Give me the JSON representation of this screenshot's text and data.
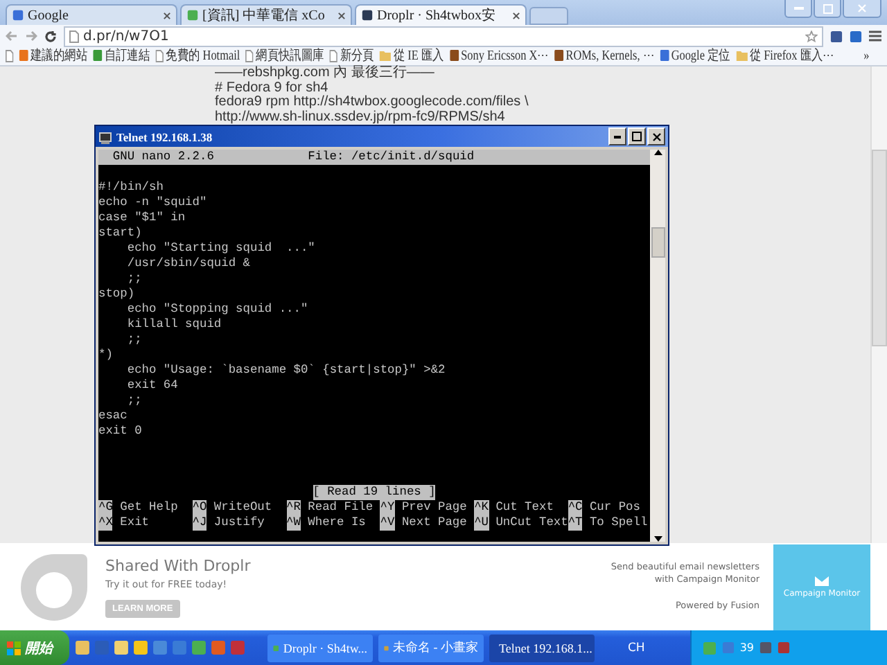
{
  "browser": {
    "tabs": [
      {
        "label": "Google",
        "selected": false
      },
      {
        "label": "[資訊] 中華電信 xCo",
        "selected": false
      },
      {
        "label": "Droplr · Sh4twbox安",
        "selected": true
      }
    ],
    "address": "d.pr/n/w7O1",
    "bookmarks": [
      {
        "label": "建議的網站",
        "kind": "site",
        "color": "#e8731c"
      },
      {
        "label": "自訂連結",
        "kind": "site",
        "color": "#3a9a3a"
      },
      {
        "label": "免費的 Hotmail",
        "kind": "page"
      },
      {
        "label": "網頁快訊圖庫",
        "kind": "page"
      },
      {
        "label": "新分頁",
        "kind": "page"
      },
      {
        "label": "從 IE 匯入",
        "kind": "folder"
      },
      {
        "label": "Sony Ericsson X⋯",
        "kind": "site",
        "color": "#8a4b1c"
      },
      {
        "label": "ROMs, Kernels, ⋯",
        "kind": "site",
        "color": "#8a4b1c"
      },
      {
        "label": "Google 定位",
        "kind": "site",
        "color": "#3a6fd8"
      },
      {
        "label": "從 Firefox 匯入⋯",
        "kind": "folder"
      }
    ],
    "more": "»",
    "page_lines": [
      "——rebshpkg.com 內 最後三行——",
      "# Fedora 9 for sh4",
      "fedora9 rpm http://sh4twbox.googlecode.com/files \\",
      "http://www.sh-linux.ssdev.jp/rpm-fc9/RPMS/sh4"
    ]
  },
  "telnet": {
    "title": "Telnet 192.168.1.38",
    "nano_version": "GNU nano 2.2.6",
    "file": "File: /etc/init.d/squid",
    "lines": [
      "#!/bin/sh",
      "echo -n \"squid\"",
      "case \"$1\" in",
      "start)",
      "    echo \"Starting squid  ...\"",
      "    /usr/sbin/squid &",
      "    ;;",
      "stop)",
      "    echo \"Stopping squid ...\"",
      "    killall squid",
      "    ;;",
      "*)",
      "    echo \"Usage: `basename $0` {start|stop}\" >&2",
      "    exit 64",
      "    ;;",
      "esac",
      "exit 0"
    ],
    "status": "[ Read 19 lines ]",
    "shortcuts": [
      [
        {
          "key": "^G",
          "label": "Get Help"
        },
        {
          "key": "^O",
          "label": "WriteOut"
        },
        {
          "key": "^R",
          "label": "Read File"
        },
        {
          "key": "^Y",
          "label": "Prev Page"
        },
        {
          "key": "^K",
          "label": "Cut Text"
        },
        {
          "key": "^C",
          "label": "Cur Pos"
        }
      ],
      [
        {
          "key": "^X",
          "label": "Exit"
        },
        {
          "key": "^J",
          "label": "Justify"
        },
        {
          "key": "^W",
          "label": "Where Is"
        },
        {
          "key": "^V",
          "label": "Next Page"
        },
        {
          "key": "^U",
          "label": "UnCut Text"
        },
        {
          "key": "^T",
          "label": "To Spell"
        }
      ]
    ]
  },
  "ad": {
    "title": "Shared With Droplr",
    "subtitle": "Try it out for FREE today!",
    "button": "LEARN MORE",
    "promo": "Send beautiful email newsletters with Campaign Monitor",
    "powered": "Powered by Fusion",
    "banner": "Campaign Monitor"
  },
  "taskbar": {
    "start": "開始",
    "tasks": [
      {
        "label": "Droplr · Sh4tw...",
        "selected": false
      },
      {
        "label": "未命名 - 小畫家",
        "selected": false
      },
      {
        "label": "Telnet 192.168.1...",
        "selected": true
      }
    ],
    "language": "CH",
    "tray_text": "39"
  }
}
